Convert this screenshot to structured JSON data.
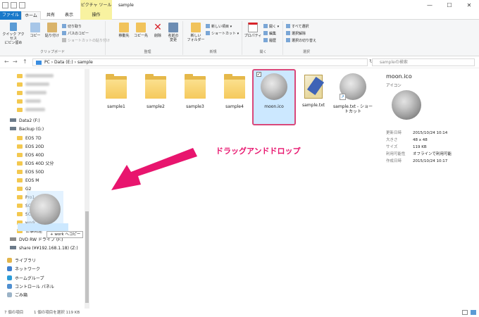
{
  "window": {
    "title": "sample",
    "context_tab_top": "ピクチャ ツール",
    "min": "—",
    "max": "☐",
    "close": "✕"
  },
  "tabs": {
    "file": "ファイル",
    "home": "ホーム",
    "share": "共有",
    "view": "表示",
    "context": "操作"
  },
  "ribbon": {
    "clipboard": {
      "quick_access": "クイック アクセス\nにピン留め",
      "copy": "コピー",
      "paste": "貼り付け",
      "cut": "切り取り",
      "copy_path": "パスのコピー",
      "paste_shortcut": "ショートカットの貼り付け",
      "label": "クリップボード"
    },
    "organize": {
      "move_to": "移動先",
      "copy_to": "コピー先",
      "delete": "削除",
      "rename": "名前の\n変更",
      "label": "整理"
    },
    "new": {
      "new_folder": "新しい\nフォルダー",
      "new_item": "新しい項目 ▾",
      "shortcut": "ショートカット ▾",
      "label": "新規"
    },
    "open": {
      "properties": "プロパティ",
      "open": "開く ▾",
      "edit": "編集",
      "history": "履歴",
      "label": "開く"
    },
    "select": {
      "select_all": "すべて選択",
      "select_none": "選択解除",
      "invert": "選択の切り替え",
      "label": "選択"
    }
  },
  "address": {
    "path": "PC  ›  Data (E:)  ›  sample",
    "search_placeholder": "sampleの検索",
    "back": "←",
    "forward": "→",
    "up": "↑",
    "refresh": "↻"
  },
  "sidebar": {
    "items": [
      {
        "label": "",
        "type": "blur",
        "w": 40
      },
      {
        "label": "",
        "type": "blur",
        "w": 34
      },
      {
        "label": "",
        "type": "blur",
        "w": 30
      },
      {
        "label": "",
        "type": "blur",
        "w": 22
      },
      {
        "label": "",
        "type": "blur",
        "w": 28
      },
      {
        "label": "Data2 (F:)",
        "type": "drive"
      },
      {
        "label": "Backup (G:)",
        "type": "drive"
      },
      {
        "label": "EOS 7D",
        "type": "folder"
      },
      {
        "label": "EOS 20D",
        "type": "folder"
      },
      {
        "label": "EOS 40D",
        "type": "folder"
      },
      {
        "label": "EOS 40D 父分",
        "type": "folder"
      },
      {
        "label": "EOS 50D",
        "type": "folder"
      },
      {
        "label": "EOS M",
        "type": "folder"
      },
      {
        "label": "G2",
        "type": "folder"
      },
      {
        "label": "Pro1",
        "type": "folder"
      },
      {
        "label": "SCI",
        "type": "folder"
      },
      {
        "label": "SCI",
        "type": "folder"
      },
      {
        "label": "work",
        "type": "folder"
      },
      {
        "label": "仕事関連",
        "type": "folder"
      },
      {
        "label": "DVD RW ドライブ (F:)",
        "type": "dvd"
      },
      {
        "label": "share (¥¥192.168.1.18) (Z:)",
        "type": "net"
      },
      {
        "label": "ライブラリ",
        "type": "lib"
      },
      {
        "label": "ネットワーク",
        "type": "netw"
      },
      {
        "label": "ホームグループ",
        "type": "home"
      },
      {
        "label": "コントロール パネル",
        "type": "cp"
      },
      {
        "label": "ごみ箱",
        "type": "bin"
      }
    ],
    "drag_tooltip": "+ work へコピー"
  },
  "files": [
    {
      "name": "sample1",
      "type": "folder"
    },
    {
      "name": "sample2",
      "type": "folder"
    },
    {
      "name": "sample3",
      "type": "folder"
    },
    {
      "name": "sample4",
      "type": "folder"
    },
    {
      "name": "moon.ico",
      "type": "ico",
      "selected": true
    },
    {
      "name": "sample.txt",
      "type": "txt"
    },
    {
      "name": "sample.txt - ショートカット",
      "type": "lnk"
    }
  ],
  "annotation": "ドラッグアンドドロップ",
  "preview": {
    "name": "moon.ico",
    "type": "アイコン",
    "rows": [
      {
        "k": "更新日時",
        "v": "2015/10/24 10:14"
      },
      {
        "k": "大きさ",
        "v": "48 x 48"
      },
      {
        "k": "サイズ",
        "v": "119 KB"
      },
      {
        "k": "利用可能性",
        "v": "オフラインで利用可能"
      },
      {
        "k": "作成日時",
        "v": "2015/10/24 10:17"
      }
    ]
  },
  "status": {
    "count": "7 個の項目",
    "selected": "1 個の項目を選択  119 KB"
  },
  "colors": {
    "accent": "#1979ca",
    "highlight": "#cce8ff",
    "annotation": "#e8156e",
    "folder": "#f5c95c"
  }
}
